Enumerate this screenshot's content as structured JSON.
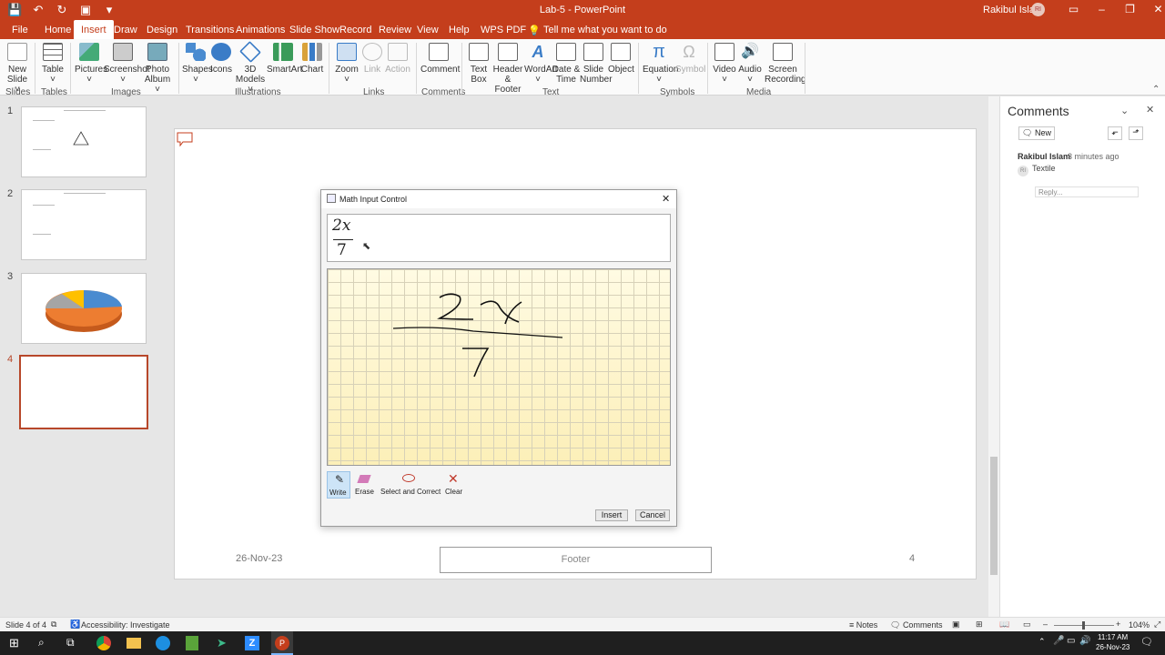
{
  "window": {
    "title": "Lab-5 - PowerPoint",
    "user": "Rakibul Islam",
    "user_initials": "RI",
    "minimize": "–",
    "restore": "❐",
    "close": "✕",
    "ribbon_display": "▭"
  },
  "qat": {
    "save": "💾",
    "undo": "↶",
    "redo": "↻",
    "present": "▣",
    "customize": "▾"
  },
  "tabs": [
    "File",
    "Home",
    "Insert",
    "Draw",
    "Design",
    "Transitions",
    "Animations",
    "Slide Show",
    "Record",
    "Review",
    "View",
    "Help",
    "WPS PDF"
  ],
  "tell_me": "Tell me what you want to do",
  "ribbon": {
    "new_slide": "New\nSlide ˅",
    "table": "Table\n˅",
    "pictures": "Pictures\n˅",
    "screenshot": "Screenshot\n˅",
    "photo_album": "Photo\nAlbum ˅",
    "shapes": "Shapes\n˅",
    "icons": "Icons",
    "models": "3D\nModels ˅",
    "smartart": "SmartArt",
    "chart": "Chart",
    "zoom": "Zoom\n˅",
    "link": "Link",
    "action": "Action",
    "comment": "Comment",
    "textbox": "Text\nBox",
    "header_footer": "Header\n& Footer",
    "wordart": "WordArt\n˅",
    "datetime": "Date &\nTime",
    "slide_number": "Slide\nNumber",
    "object": "Object",
    "equation": "Equation\n˅",
    "symbol": "Symbol",
    "video": "Video\n˅",
    "audio": "Audio\n˅",
    "screen_recording": "Screen\nRecording",
    "groups": {
      "slides": "Slides",
      "tables": "Tables",
      "images": "Images",
      "illustrations": "Illustrations",
      "links": "Links",
      "comments": "Comments",
      "text": "Text",
      "symbols": "Symbols",
      "media": "Media"
    }
  },
  "slides": [
    {
      "num": "1"
    },
    {
      "num": "2"
    },
    {
      "num": "3"
    },
    {
      "num": "4"
    }
  ],
  "slide": {
    "date": "26-Nov-23",
    "footer": "Footer",
    "page": "4"
  },
  "dialog": {
    "title": "Math Input Control",
    "preview_num": "2x",
    "preview_den": "7",
    "tools": [
      {
        "label": "Write"
      },
      {
        "label": "Erase"
      },
      {
        "label": "Select and Correct"
      },
      {
        "label": "Clear"
      }
    ],
    "insert": "Insert",
    "cancel": "Cancel"
  },
  "comments": {
    "title": "Comments",
    "new": "New",
    "author": "Rakibul Islam",
    "time": "3 minutes ago",
    "text": "Textile",
    "reply_placeholder": "Reply...",
    "initials": "RI"
  },
  "status": {
    "slide_info": "Slide 4 of 4",
    "accessibility": "Accessibility: Investigate",
    "notes": "Notes",
    "comments": "Comments",
    "zoom": "104%"
  },
  "taskbar": {
    "time": "11:17 AM",
    "date": "26-Nov-23"
  }
}
